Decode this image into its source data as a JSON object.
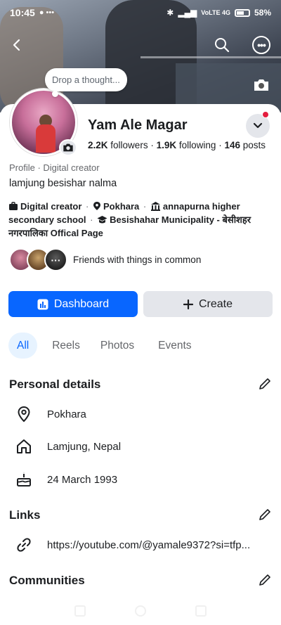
{
  "status_bar": {
    "time": "10:45",
    "notif_icons": "● •••",
    "network": "VoLTE 4G",
    "battery": "58%"
  },
  "cover": {
    "thought_placeholder": "Drop a thought..."
  },
  "profile": {
    "name": "Yam Ale Magar",
    "followers_count": "2.2K",
    "followers_label": "followers",
    "following_count": "1.9K",
    "following_label": "following",
    "posts_count": "146",
    "posts_label": "posts",
    "category": "Profile · Digital creator",
    "bio": "lamjung besishar nalma",
    "intro": {
      "item1": "Digital creator",
      "item2": "Pokhara",
      "item3": "annapurna higher secondary school",
      "item4": "Besishahar Municipality - बेसीशहर नगरपालिका Offical Page"
    },
    "friends_label": "Friends with things in common"
  },
  "actions": {
    "dashboard_label": "Dashboard",
    "create_label": "Create"
  },
  "tabs": {
    "all": "All",
    "reels": "Reels",
    "photos": "Photos",
    "events": "Events"
  },
  "personal_details": {
    "title": "Personal details",
    "location": "Pokhara",
    "hometown": "Lamjung, Nepal",
    "birthday": "24 March 1993"
  },
  "links": {
    "title": "Links",
    "youtube": "https://youtube.com/@yamale9372?si=tfp..."
  },
  "communities": {
    "title": "Communities"
  },
  "colors": {
    "primary": "#0866ff",
    "secondary_button": "#e4e6eb",
    "text": "#1c1e21",
    "muted": "#65676b"
  }
}
